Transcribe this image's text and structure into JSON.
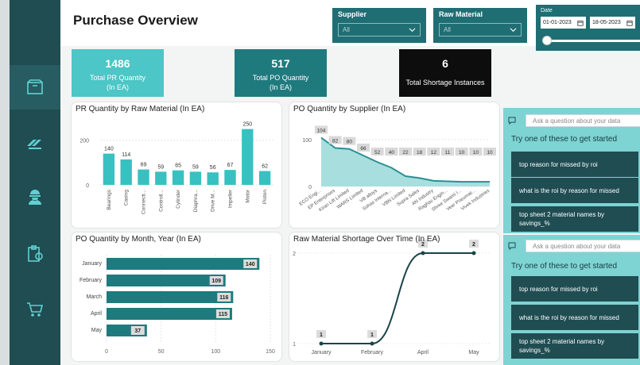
{
  "page": {
    "title": "Purchase Overview"
  },
  "sidebar": {
    "items": [
      {
        "icon": "box-icon",
        "active": true
      },
      {
        "icon": "conveyor-icon",
        "active": false
      },
      {
        "icon": "worker-icon",
        "active": false
      },
      {
        "icon": "clipboard-icon",
        "active": false
      },
      {
        "icon": "cart-icon",
        "active": false
      }
    ]
  },
  "filters": {
    "supplier": {
      "label": "Supplier",
      "value": "All"
    },
    "raw_material": {
      "label": "Raw Material",
      "value": "All"
    },
    "date": {
      "label": "Date",
      "start": "01-01-2023",
      "end": "18-05-2023"
    }
  },
  "kpis": [
    {
      "value": "1486",
      "label_line1": "Total PR Quantity",
      "label_line2": "(In EA)",
      "color": "#4cc6c6"
    },
    {
      "value": "517",
      "label_line1": "Total PO Quantity",
      "label_line2": "(In EA)",
      "color": "#1f7a7e"
    },
    {
      "value": "6",
      "label_line1": "Total Shortage Instances",
      "label_line2": "",
      "color": "#0d0d0d"
    }
  ],
  "panels": {
    "pr_by_material": "PR Quantity by Raw Material (In EA)",
    "po_by_supplier": "PO Quantity by Supplier (In EA)",
    "po_by_month": "PO Quantity by Month, Year (In EA)",
    "shortage_over_time": "Raw Material Shortage Over Time (In EA)"
  },
  "chart_data": [
    {
      "type": "bar",
      "title": "PR Quantity by Raw Material (In EA)",
      "categories": [
        "Bearings",
        "Casing",
        "Connecti...",
        "Controll...",
        "Cylinder",
        "Diaphra...",
        "Drive M...",
        "Impeller",
        "Motor",
        "Piston"
      ],
      "values": [
        140,
        114,
        69,
        59,
        65,
        59,
        56,
        67,
        250,
        62
      ],
      "yticks": [
        0,
        200
      ],
      "ylim": [
        0,
        270
      ],
      "color": "#38c1c1"
    },
    {
      "type": "area",
      "title": "PO Quantity by Supplier (In EA)",
      "categories": [
        "ECO Engi...",
        "EP Enterprises",
        "Kiran Lift Limited",
        "WARS Limited",
        "VB alloys",
        "Sohas Interna...",
        "VBN Limited",
        "Supra Sales",
        "AN Industry",
        "Raghav Engin...",
        "Shree Swami I...",
        "Veer Pneumat...",
        "Vivek Industries"
      ],
      "values": [
        104,
        82,
        80,
        66,
        52,
        40,
        22,
        18,
        12,
        11,
        10,
        10,
        10
      ],
      "yticks": [
        0,
        100
      ],
      "ylim": [
        0,
        115
      ],
      "color": "#2a8f93"
    },
    {
      "type": "bar",
      "orientation": "horizontal",
      "title": "PO Quantity by Month, Year (In EA)",
      "categories": [
        "January",
        "February",
        "March",
        "April",
        "May"
      ],
      "values": [
        140,
        109,
        116,
        115,
        37
      ],
      "xticks": [
        0,
        50,
        100,
        150
      ],
      "xlim": [
        0,
        150
      ],
      "color": "#1f7a7e"
    },
    {
      "type": "line",
      "title": "Raw Material Shortage Over Time (In EA)",
      "categories": [
        "January",
        "February",
        "April",
        "May"
      ],
      "values": [
        1,
        1,
        2,
        2
      ],
      "yticks": [
        1,
        2
      ],
      "ylim": [
        1,
        2
      ],
      "color": "#1a4448"
    }
  ],
  "qa": [
    {
      "placeholder": "Ask a question about your data",
      "prompt": "Try one of these to get started",
      "suggestions": [
        "top reason for missed by roi",
        "what is the roi by reason for missed",
        "top sheet 2 material names by savings_%"
      ]
    },
    {
      "placeholder": "Ask a question about your data",
      "prompt": "Try one of these to get started",
      "suggestions": [
        "top reason for missed by roi",
        "what is the roi by reason for missed",
        "top sheet 2 material names by savings_%"
      ]
    }
  ]
}
